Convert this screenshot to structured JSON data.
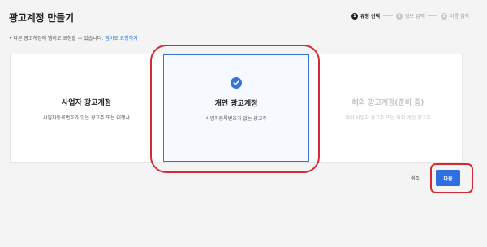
{
  "header": {
    "title": "광고계정 만들기"
  },
  "steps": [
    {
      "num": "1",
      "label": "유형 선택"
    },
    {
      "num": "2",
      "label": "정보 입력"
    },
    {
      "num": "3",
      "label": "이름 입력"
    }
  ],
  "notice": {
    "text": "• 다른 광고계정에 멤버로 요청할 수 있습니다.",
    "link": "멤버로 요청하기"
  },
  "cards": [
    {
      "title": "사업자 광고계정",
      "desc": "사업자등록번호가 있는 광고주 또는 대행사"
    },
    {
      "title": "개인 광고계정",
      "desc": "사업자등록번호가 없는 광고주",
      "selected": true
    },
    {
      "title": "해외 광고계정(준비 중)",
      "desc": "해외 사업자 광고주 또는 해외 개인 광고주",
      "disabled": true
    }
  ],
  "actions": {
    "cancel": "취소",
    "next": "다음"
  },
  "colors": {
    "accent": "#2f6fe0",
    "highlight": "#d42a36"
  },
  "icons": {
    "selected": "check-circle-icon"
  }
}
